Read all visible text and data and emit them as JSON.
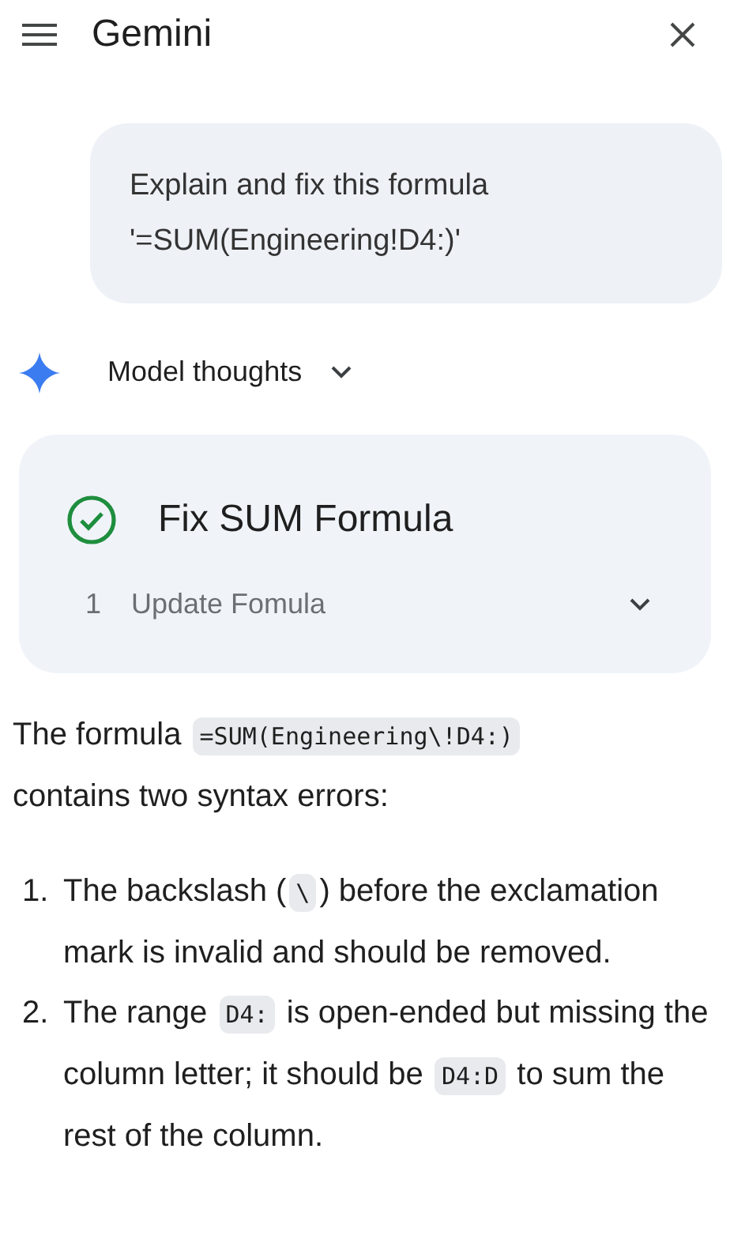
{
  "header": {
    "title": "Gemini"
  },
  "user_message": {
    "lines": [
      "Explain and fix this formula",
      "'=SUM(Engineering!D4:)'"
    ]
  },
  "thoughts": {
    "label": "Model thoughts",
    "expanded": false
  },
  "task_card": {
    "title": "Fix SUM Formula",
    "done": true,
    "steps": [
      {
        "number": "1",
        "label": "Update Fomula",
        "expanded": false
      }
    ]
  },
  "answer": {
    "intro": [
      {
        "kind": "text",
        "text": "The formula "
      },
      {
        "kind": "code",
        "text": "=SUM(Engineering\\!D4:)"
      },
      {
        "kind": "text",
        "text": " contains two syntax errors:"
      }
    ],
    "items": [
      {
        "number": "1.",
        "parts": [
          {
            "kind": "text",
            "text": "The backslash ("
          },
          {
            "kind": "code",
            "text": "\\"
          },
          {
            "kind": "text",
            "text": ") before the exclamation mark is invalid and should be removed."
          }
        ]
      },
      {
        "number": "2.",
        "parts": [
          {
            "kind": "text",
            "text": "The range "
          },
          {
            "kind": "code",
            "text": "D4:"
          },
          {
            "kind": "text",
            "text": " is open-ended but missing the column letter; it should be "
          },
          {
            "kind": "code",
            "text": "D4:D"
          },
          {
            "kind": "text",
            "text": " to sum the rest of the column."
          }
        ]
      }
    ]
  }
}
